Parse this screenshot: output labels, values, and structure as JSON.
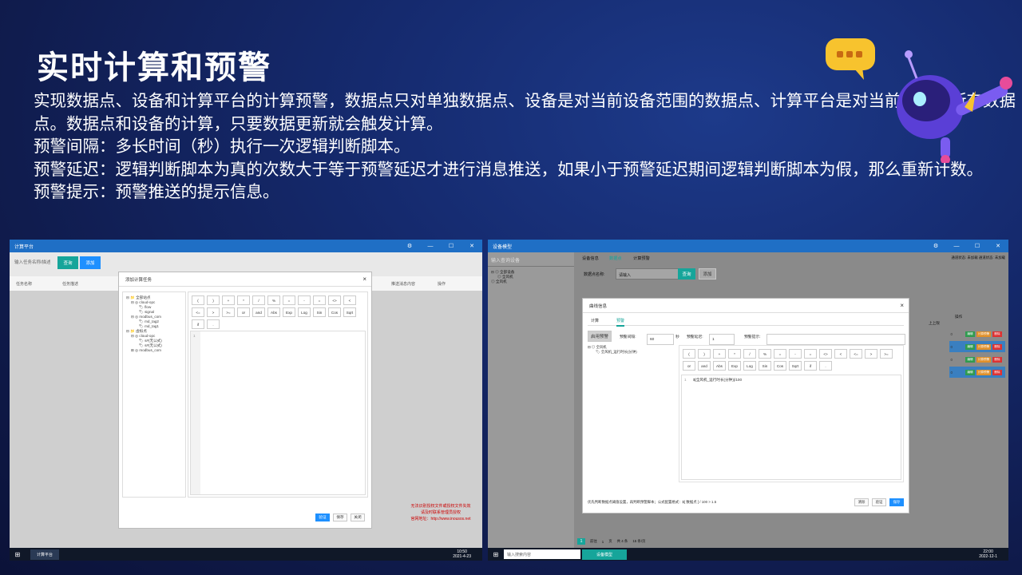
{
  "slide": {
    "title": "实时计算和预警",
    "paragraphs": [
      "实现数据点、设备和计算平台的计算预警，数据点只对单独数据点、设备是对当前设备范围的数据点、计算平台是对当前平台的所有数据点。数据点和设备的计算，只要数据更新就会触发计算。",
      "预警间隔：多长时间（秒）执行一次逻辑判断脚本。",
      "预警延迟：逻辑判断脚本为真的次数大于等于预警延迟才进行消息推送，如果小于预警延迟期间逻辑判断脚本为假，那么重新计数。",
      "预警提示：预警推送的提示信息。"
    ]
  },
  "window1": {
    "title": "计算平台",
    "controls": [
      "⚙",
      "—",
      "☐",
      "✕"
    ],
    "search_placeholder": "输入任务名称/描述",
    "query_button": "查询",
    "add_button": "添加",
    "columns": [
      "任务名称",
      "任务描述",
      "推送消息内容",
      "操作"
    ],
    "license_notice": [
      "无法识别授权文件或授权文件失效",
      "请及时联系管理员授权",
      "官网地址：http://www.inousos.net"
    ],
    "dialog": {
      "title": "添加计算任务",
      "tree": [
        "全部站点",
        "cloud-opc",
        "flow",
        "signal",
        "modbus_com",
        "md_tag2",
        "md_tag1",
        "虚拟点",
        "cloud-opc",
        "s#(无公式)",
        "s#(无公式)",
        "modbus_com"
      ],
      "keys_row1": [
        "(",
        ")",
        "+",
        "*",
        "/",
        "%",
        "=",
        "-",
        "=",
        "<>",
        "<",
        "<=",
        ">"
      ],
      "keys_row2": [
        ">=",
        "or",
        "and",
        "Abs",
        "Exp",
        "Log",
        "Sin",
        "Cos",
        "Sqrt",
        "if",
        "."
      ],
      "line_number": "1",
      "buttons": [
        "验证",
        "保存",
        "关闭"
      ]
    },
    "taskbar": {
      "app": "计算平台",
      "time": "10:50",
      "date": "2021-4-23"
    }
  },
  "window2": {
    "title": "设备模型",
    "controls": [
      "⚙",
      "—",
      "☐",
      "✕"
    ],
    "left_search": "输入查询设备",
    "left_tree": [
      "全部设备",
      "全风机",
      "全风机"
    ],
    "tabs": [
      "设备信息",
      "数据点",
      "计算预警"
    ],
    "status": "通道状态: 未加载   通道状态: 未加载",
    "filter_label": "数据点名称:",
    "filter_placeholder": "请输入",
    "query_button": "查询",
    "add_button": "添加",
    "column_ops": "操作",
    "column_upper": "上上限",
    "row_values": [
      "0",
      "0",
      "0",
      "0"
    ],
    "row_actions": [
      "编辑",
      "计算预警",
      "删除"
    ],
    "pager": [
      "1",
      "前往",
      "1",
      "页",
      "共 4 条",
      "15 条/页"
    ],
    "dialog": {
      "title": "曲线信息",
      "tabs": [
        "计算",
        "预警"
      ],
      "active_tab": "预警",
      "enable_label": "启用预警",
      "interval_label": "预警间隔:",
      "interval_value": "60",
      "interval_unit": "秒",
      "delay_label": "预警延迟:",
      "delay_value": "1",
      "hint_label": "预警提示:",
      "tree": [
        "全风机",
        "全风机_运行时长(分钟)"
      ],
      "keys_row1": [
        "(",
        ")",
        "+",
        "*",
        "/",
        "%",
        "=",
        "-",
        "=",
        "<>",
        "<",
        "<=",
        ">",
        ">=",
        "or",
        "and"
      ],
      "keys_row2": [
        "Abs",
        "Exp",
        "Log",
        "Sin",
        "Cos",
        "Sqrt",
        "if",
        "."
      ],
      "code": "$[全风机_运行时长(分钟)]/100",
      "note": "优先判断数据点阈值设置，再判断预警脚本；公式配置格式：$[ 数据点 ] / 100 > 1.5",
      "buttons": [
        "清除",
        "验证",
        "保存"
      ]
    },
    "taskbar": {
      "search": "输入搜索内容",
      "app": "设备模型",
      "time": "22:00",
      "date": "2022-12-1"
    }
  },
  "colors": {
    "accent": "#1e90ff",
    "teal": "#16a59a",
    "titlebar": "#1f6fc5"
  }
}
